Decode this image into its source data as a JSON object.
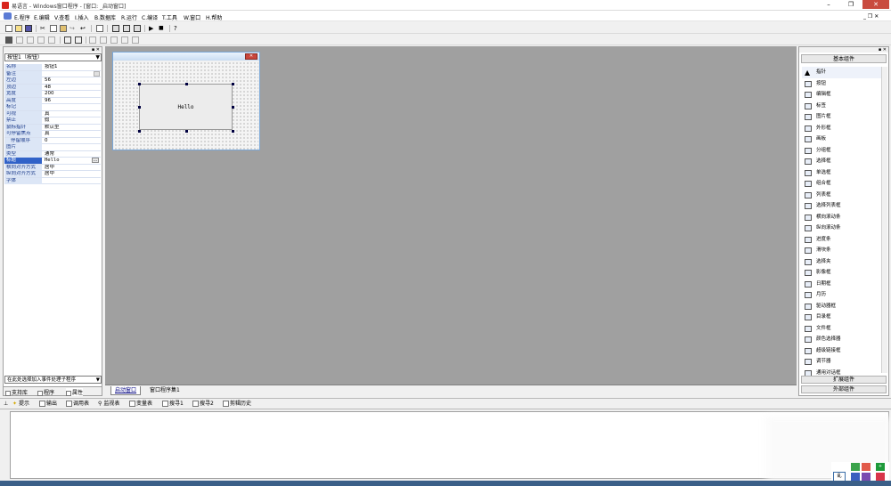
{
  "window": {
    "title": "易语言 - Windows窗口程序 - [窗口: _启动窗口]",
    "min": "–",
    "restore": "❐",
    "close": "✕"
  },
  "menu": {
    "items": [
      "E.程序",
      "E.编辑",
      "V.查看",
      "I.插入",
      "B.数据库",
      "R.运行",
      "C.编译",
      "T.工具",
      "W.窗口",
      "H.帮助"
    ],
    "mdi_buttons": "_ ❐ ✕"
  },
  "left_panel": {
    "header_buttons": "▪ ✕",
    "selector": "按钮1（按钮）",
    "properties": [
      {
        "name": "名称",
        "value": "按钮1"
      },
      {
        "name": "备注",
        "value": ""
      },
      {
        "name": "左边",
        "value": "56"
      },
      {
        "name": "顶边",
        "value": "48"
      },
      {
        "name": "宽度",
        "value": "200"
      },
      {
        "name": "高度",
        "value": "96"
      },
      {
        "name": "标记",
        "value": ""
      },
      {
        "name": "可视",
        "value": "真"
      },
      {
        "name": "禁止",
        "value": "假"
      },
      {
        "name": "鼠标指针",
        "value": "默认型"
      },
      {
        "name": "可停留焦点",
        "value": "真"
      },
      {
        "name": "停留顺序",
        "value": "0"
      },
      {
        "name": "图片",
        "value": ""
      },
      {
        "name": "类型",
        "value": "通常"
      },
      {
        "name": "标题",
        "value": "Hello"
      },
      {
        "name": "横向对齐方式",
        "value": "居中"
      },
      {
        "name": "纵向对齐方式",
        "value": "居中"
      },
      {
        "name": "字体",
        "value": ""
      }
    ],
    "event_selector": "在此处选择加入事件处理子程序",
    "tabs": [
      "支持库",
      "程序",
      "属性"
    ]
  },
  "designer": {
    "form_close": "✕",
    "button_caption": "Hello",
    "tabs": [
      "启动窗口",
      "窗口程序集1"
    ]
  },
  "right_panel": {
    "header_buttons": "▪ ✕",
    "title": "基本组件",
    "components": [
      {
        "label": "指针",
        "icon": "pointer-icon"
      },
      {
        "label": "按钮",
        "icon": "button-icon"
      },
      {
        "label": "编辑框",
        "icon": "edit-box-icon"
      },
      {
        "label": "标签",
        "icon": "label-icon"
      },
      {
        "label": "图片框",
        "icon": "picture-box-icon"
      },
      {
        "label": "外形框",
        "icon": "shape-box-icon"
      },
      {
        "label": "画板",
        "icon": "drawing-board-icon"
      },
      {
        "label": "分组框",
        "icon": "group-box-icon"
      },
      {
        "label": "选择框",
        "icon": "check-box-icon"
      },
      {
        "label": "单选框",
        "icon": "radio-box-icon"
      },
      {
        "label": "组合框",
        "icon": "combo-box-icon"
      },
      {
        "label": "列表框",
        "icon": "list-box-icon"
      },
      {
        "label": "选择列表框",
        "icon": "check-list-box-icon"
      },
      {
        "label": "横向滚动条",
        "icon": "hscroll-icon"
      },
      {
        "label": "纵向滚动条",
        "icon": "vscroll-icon"
      },
      {
        "label": "进度条",
        "icon": "progress-bar-icon"
      },
      {
        "label": "滑块条",
        "icon": "slider-icon"
      },
      {
        "label": "选择夹",
        "icon": "tab-control-icon"
      },
      {
        "label": "影像框",
        "icon": "image-box-icon"
      },
      {
        "label": "日期框",
        "icon": "date-box-icon"
      },
      {
        "label": "月历",
        "icon": "calendar-icon"
      },
      {
        "label": "驱动器框",
        "icon": "drive-box-icon"
      },
      {
        "label": "目录框",
        "icon": "directory-box-icon"
      },
      {
        "label": "文件框",
        "icon": "file-box-icon"
      },
      {
        "label": "颜色选择器",
        "icon": "color-picker-icon"
      },
      {
        "label": "超级链接框",
        "icon": "hyperlink-icon"
      },
      {
        "label": "调节器",
        "icon": "spinner-icon"
      },
      {
        "label": "通用对话框",
        "icon": "common-dialog-icon"
      }
    ],
    "buttons": [
      "扩展组件",
      "外部组件"
    ]
  },
  "bottom_tabs": [
    "提示",
    "输出",
    "调用表",
    "监视表",
    "变量表",
    "搜寻1",
    "搜寻2",
    "剪辑历史"
  ]
}
